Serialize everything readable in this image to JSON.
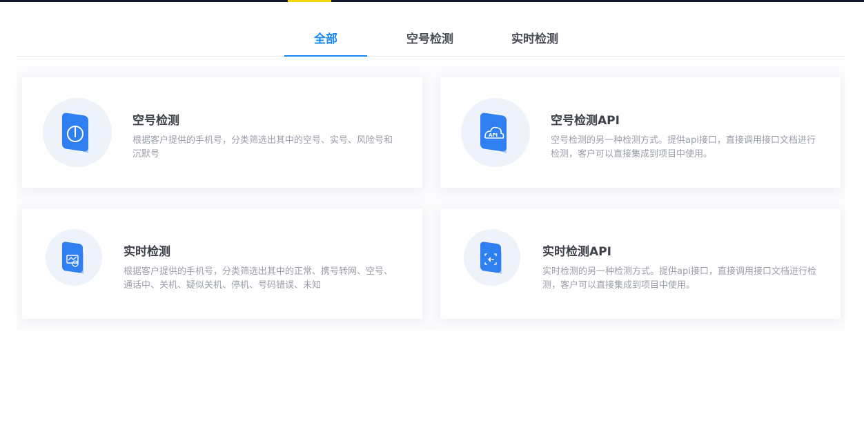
{
  "tabs": [
    {
      "label": "全部",
      "active": true
    },
    {
      "label": "空号检测",
      "active": false
    },
    {
      "label": "实时检测",
      "active": false
    }
  ],
  "cards": [
    {
      "title": "空号检测",
      "description": "根据客户提供的手机号，分类筛选出其中的空号、实号、风险号和沉默号",
      "icon": "power-icon"
    },
    {
      "title": "空号检测API",
      "description": "空号检测的另一种检测方式。提供api接口，直接调用接口文档进行检测，客户可以直接集成到项目中使用。",
      "icon": "cloud-api-icon",
      "icon_text": "API"
    },
    {
      "title": "实时检测",
      "description": "根据客户提供的手机号，分类筛选出其中的正常、携号转网、空号、通话中、关机、疑似关机、停机、号码错误、未知",
      "icon": "realtime-icon"
    },
    {
      "title": "实时检测API",
      "description": "实时检测的另一种检测方式。提供api接口，直接调用接口文档进行检测，客户可以直接集成到项目中使用。",
      "icon": "realtime-api-icon"
    }
  ],
  "colors": {
    "accent": "#1a88f2",
    "top_bar": "#14182a",
    "top_bar_accent": "#f5d800",
    "icon_blue": "#2f7ff0"
  }
}
